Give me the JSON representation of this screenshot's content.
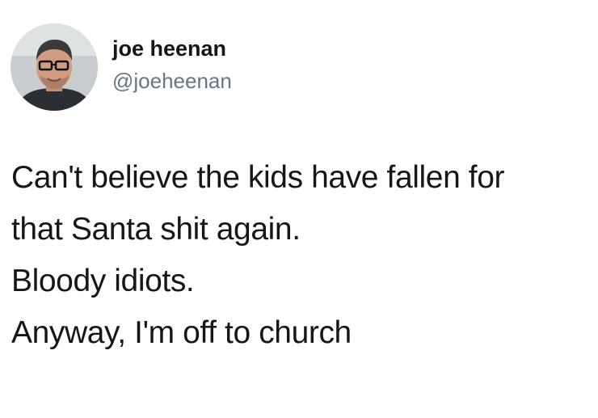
{
  "tweet": {
    "author": {
      "display_name": "joe heenan",
      "handle": "@joeheenan",
      "avatar": "profile-photo"
    },
    "lines": [
      "Can't believe the kids have fallen for",
      "that Santa shit again.",
      "Bloody idiots.",
      "Anyway, I'm off to church"
    ]
  },
  "colors": {
    "background": "#ffffff",
    "text": "#14171a",
    "handle": "#657786"
  }
}
